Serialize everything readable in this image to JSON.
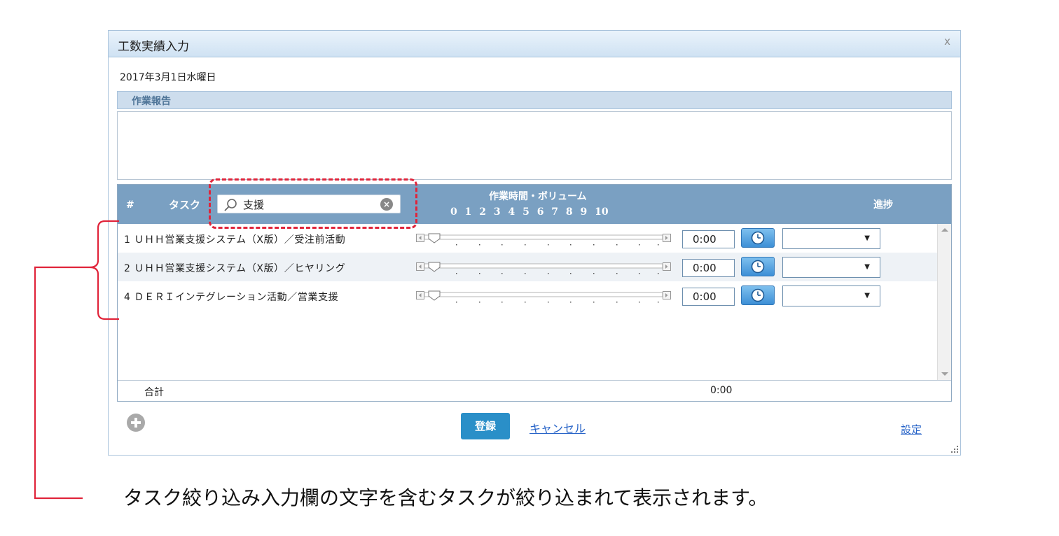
{
  "dialog": {
    "title": "工数実績入力",
    "close_label": "x",
    "date": "2017年3月1日水曜日",
    "report_section_label": "作業報告",
    "report_text": ""
  },
  "table": {
    "col_num": "#",
    "col_task": "タスク",
    "search_value": "支援",
    "col_time": "作業時間・ボリューム",
    "scale_labels": "0 1 2 3 4 5 6 7 8 9 10",
    "col_progress": "進捗",
    "rows": [
      {
        "name": "1 ＵＨＨ営業支援システム（X版）／受注前活動",
        "slider_value": 0,
        "time": "0:00",
        "progress": ""
      },
      {
        "name": "2 ＵＨＨ営業支援システム（X版）／ヒヤリング",
        "slider_value": 0,
        "time": "0:00",
        "progress": ""
      },
      {
        "name": "4 ＤＥＲＩインテグレーション活動／営業支援",
        "slider_value": 0,
        "time": "0:00",
        "progress": ""
      }
    ],
    "total_label": "合計",
    "total_value": "0:00"
  },
  "footer": {
    "save_label": "登録",
    "cancel_label": "キャンセル",
    "settings_label": "設定"
  },
  "annotation": {
    "note": "タスク絞り込み入力欄の文字を含むタスクが絞り込まれて表示されます。",
    "color": "#e0243a"
  },
  "icons": [
    "search-icon",
    "clear-icon",
    "clock-icon",
    "add-icon",
    "close-icon",
    "dropdown-arrow-icon"
  ]
}
